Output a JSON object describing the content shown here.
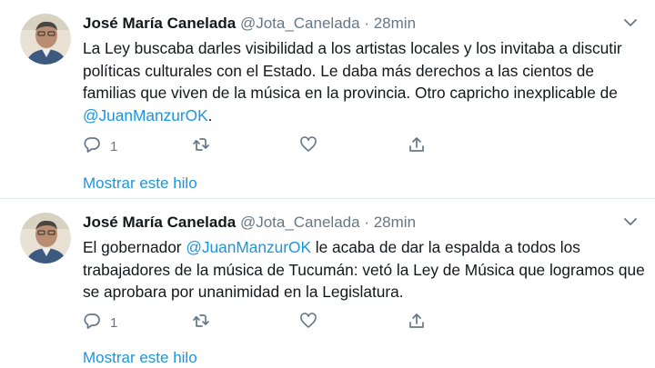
{
  "colors": {
    "link": "#1b95e0",
    "secondary_text": "#657786",
    "primary_text": "#14171a",
    "divider": "#e1e8ed"
  },
  "tweets": [
    {
      "author_name": "José María Canelada",
      "handle": "@Jota_Canelada",
      "separator": "·",
      "time": "28min",
      "text_before": "La Ley buscaba darles visibilidad a los artistas locales y los invitaba a discutir políticas culturales con el Estado. Le daba más derechos a las cientos de familias que viven de la música en la provincia. Otro capricho inexplicable de ",
      "mention": "@JuanManzurOK",
      "text_after": ".",
      "reply_count": "1",
      "icons": [
        "reply-icon",
        "retweet-icon",
        "like-icon",
        "share-icon",
        "chevron-down-icon"
      ],
      "thread_link": "Mostrar este hilo"
    },
    {
      "author_name": "José María Canelada",
      "handle": "@Jota_Canelada",
      "separator": "·",
      "time": "28min",
      "text_before": "El gobernador ",
      "mention": "@JuanManzurOK",
      "text_after": " le acaba de dar la espalda a todos los trabajadores de la música de Tucumán: vetó la Ley de Música que logramos que se aprobara por unanimidad en la Legislatura.",
      "reply_count": "1",
      "icons": [
        "reply-icon",
        "retweet-icon",
        "like-icon",
        "share-icon",
        "chevron-down-icon"
      ],
      "thread_link": "Mostrar este hilo"
    }
  ]
}
